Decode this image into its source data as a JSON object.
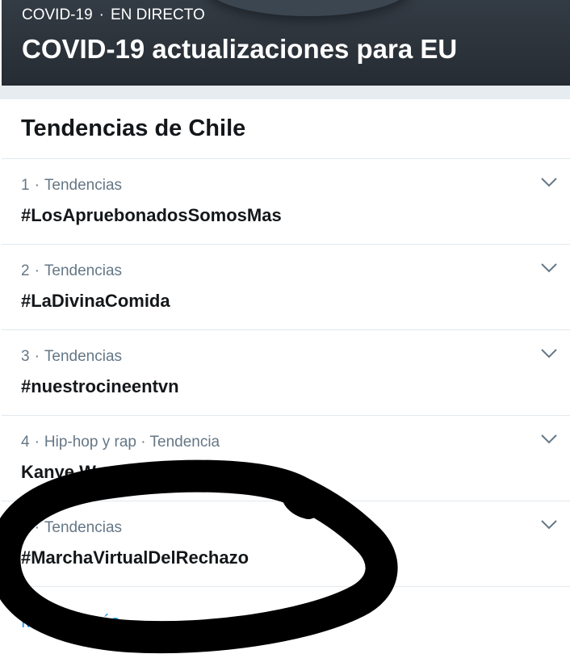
{
  "banner": {
    "category": "COVID-19",
    "status": "EN DIRECTO",
    "separator": "·",
    "title": "COVID-19 actualizaciones para EU"
  },
  "trends_section": {
    "title": "Tendencias de Chile",
    "items": [
      {
        "rank": "1",
        "context": "Tendencias",
        "name": "#LosApruebonadosSomosMas"
      },
      {
        "rank": "2",
        "context": "Tendencias",
        "name": "#LaDivinaComida"
      },
      {
        "rank": "3",
        "context": "Tendencias",
        "name": "#nuestrocineentvn"
      },
      {
        "rank": "4",
        "context": "Hip-hop y rap · Tendencia",
        "name": "Kanye West"
      },
      {
        "rank": "5",
        "context": "Tendencias",
        "name": "#MarchaVirtualDelRechazo"
      }
    ],
    "separator": "·",
    "show_more_label": "Mostrar más"
  },
  "icons": {
    "chevron": "chevron-down-icon"
  },
  "colors": {
    "banner_bg": "#2b3138",
    "divider": "#e1e8ed",
    "secondary_text": "#657786",
    "link": "#1da1f2",
    "scribble": "#000000"
  }
}
